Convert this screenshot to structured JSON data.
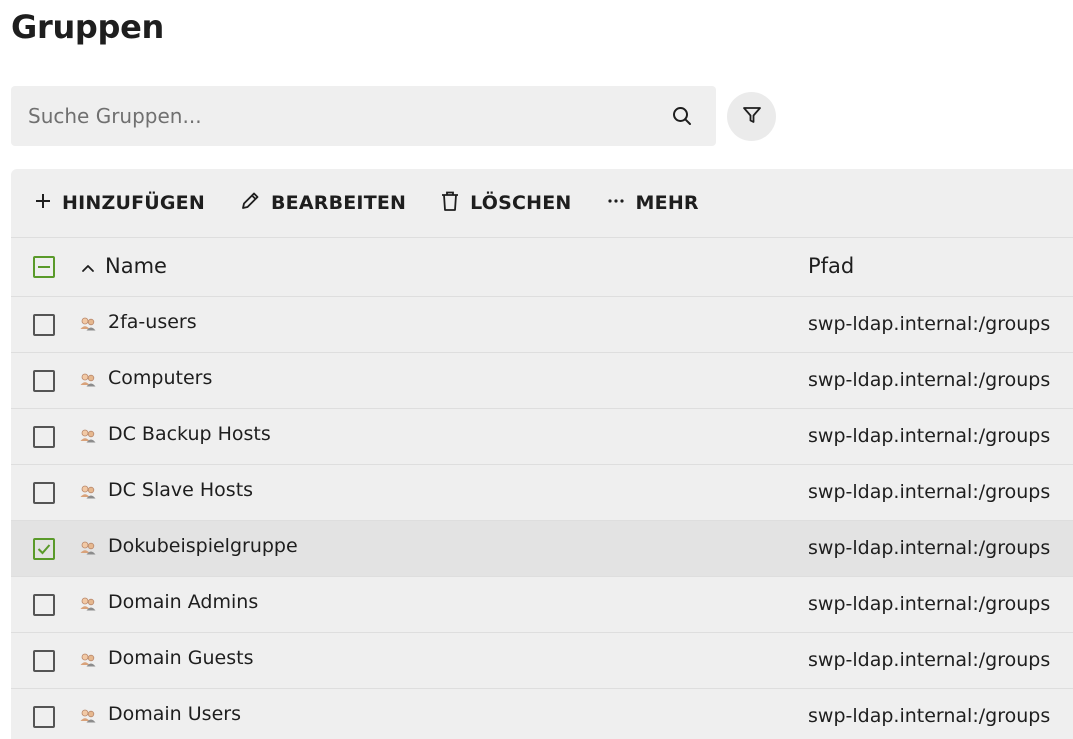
{
  "page": {
    "title": "Gruppen"
  },
  "search": {
    "placeholder": "Suche Gruppen...",
    "value": ""
  },
  "toolbar": {
    "add_label": "HINZUFÜGEN",
    "edit_label": "BEARBEITEN",
    "delete_label": "LÖSCHEN",
    "more_label": "MEHR"
  },
  "table": {
    "columns": [
      "Name",
      "Pfad"
    ],
    "sort": {
      "column": "Name",
      "direction": "ascending"
    },
    "select_all_state": "partial",
    "rows": [
      {
        "name": "2fa-users",
        "path": "swp-ldap.internal:/groups",
        "selected": false
      },
      {
        "name": "Computers",
        "path": "swp-ldap.internal:/groups",
        "selected": false
      },
      {
        "name": "DC Backup Hosts",
        "path": "swp-ldap.internal:/groups",
        "selected": false
      },
      {
        "name": "DC Slave Hosts",
        "path": "swp-ldap.internal:/groups",
        "selected": false
      },
      {
        "name": "Dokubeispielgruppe",
        "path": "swp-ldap.internal:/groups",
        "selected": true
      },
      {
        "name": "Domain Admins",
        "path": "swp-ldap.internal:/groups",
        "selected": false
      },
      {
        "name": "Domain Guests",
        "path": "swp-ldap.internal:/groups",
        "selected": false
      },
      {
        "name": "Domain Users",
        "path": "swp-ldap.internal:/groups",
        "selected": false
      }
    ]
  },
  "icons": {
    "search": "search-icon",
    "filter": "filter-icon",
    "add": "plus-icon",
    "edit": "pencil-icon",
    "delete": "trash-icon",
    "more": "ellipsis-icon",
    "sort": "chevron-up-icon",
    "group": "group-icon"
  },
  "colors": {
    "accent_green": "#5a9a2a",
    "panel_bg": "#efefef",
    "selected_row_bg": "#e3e3e3"
  }
}
